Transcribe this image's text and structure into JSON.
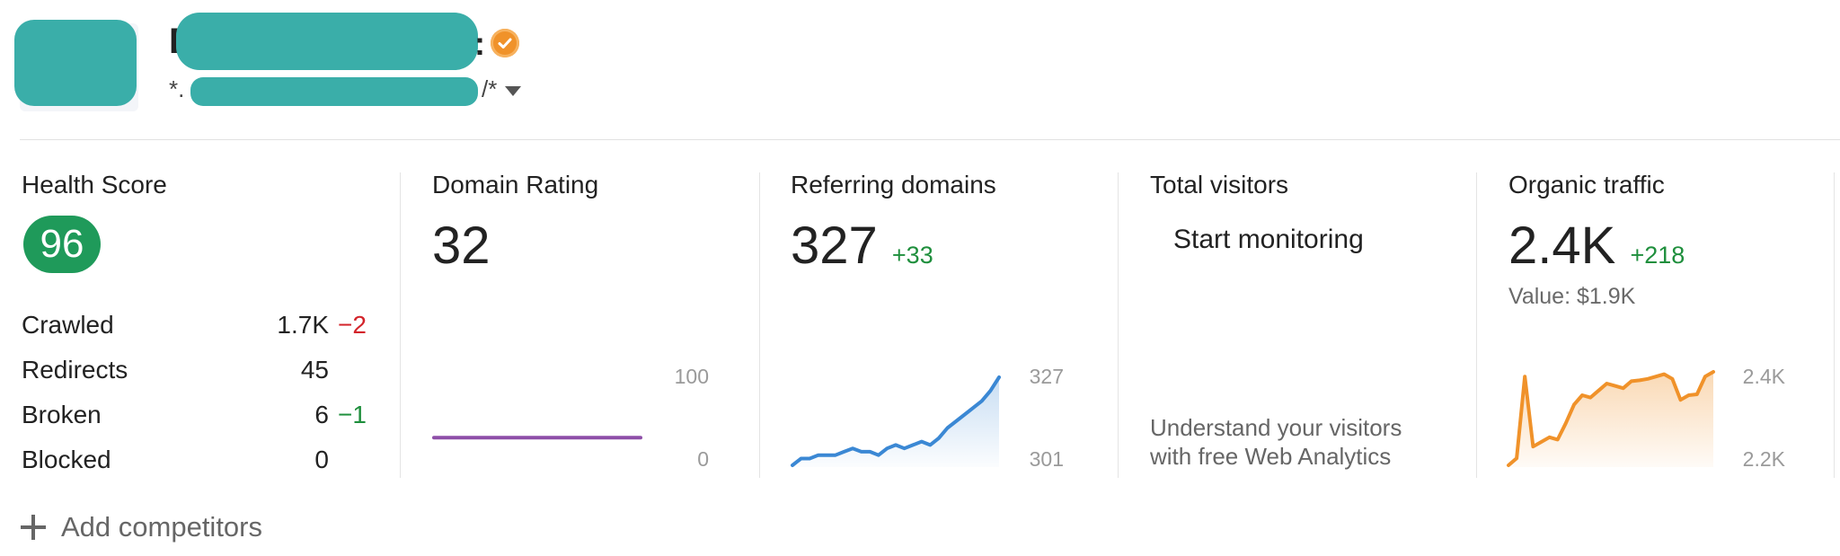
{
  "header": {
    "title_prefix": "E",
    "title_suffix": ":",
    "url_prefix": "*.",
    "url_suffix": "/*",
    "verified_icon": "verified-badge-icon",
    "accent_color": "#f0922a"
  },
  "health": {
    "label": "Health Score",
    "score": "96",
    "badge_color": "#1f9a5a",
    "rows": [
      {
        "label": "Crawled",
        "value": "1.7K",
        "delta": "−2",
        "delta_type": "down"
      },
      {
        "label": "Redirects",
        "value": "45",
        "delta": "",
        "delta_type": "none"
      },
      {
        "label": "Broken",
        "value": "6",
        "delta": "−1",
        "delta_type": "up"
      },
      {
        "label": "Blocked",
        "value": "0",
        "delta": "",
        "delta_type": "none"
      }
    ]
  },
  "domain_rating": {
    "label": "Domain Rating",
    "value": "32",
    "axis_max": "100",
    "axis_min": "0",
    "line_color": "#8e4fa8"
  },
  "referring_domains": {
    "label": "Referring domains",
    "value": "327",
    "delta": "+33",
    "axis_max": "327",
    "axis_min": "301",
    "line_color": "#3b88d4"
  },
  "total_visitors": {
    "label": "Total visitors",
    "cta": "Start monitoring",
    "description_line1": "Understand your visitors",
    "description_line2": "with free Web Analytics"
  },
  "organic_traffic": {
    "label": "Organic traffic",
    "value": "2.4K",
    "delta": "+218",
    "value_text": "Value: $1.9K",
    "axis_max": "2.4K",
    "axis_min": "2.2K",
    "line_color": "#f0922a"
  },
  "add_competitors": {
    "label": "Add competitors",
    "icon": "plus-icon"
  },
  "chart_data": [
    {
      "type": "line",
      "title": "Domain Rating",
      "ylim": [
        0,
        100
      ],
      "series": [
        {
          "values": [
            32,
            32,
            32,
            32,
            32,
            32,
            32,
            32,
            32,
            32,
            32,
            32
          ]
        }
      ]
    },
    {
      "type": "area",
      "title": "Referring domains",
      "ylim": [
        301,
        327
      ],
      "series": [
        {
          "values": [
            301,
            303,
            303,
            304,
            304,
            304,
            305,
            306,
            305,
            305,
            304,
            306,
            307,
            306,
            307,
            308,
            307,
            309,
            312,
            314,
            316,
            318,
            320,
            323,
            327
          ]
        }
      ]
    },
    {
      "type": "area",
      "title": "Organic traffic",
      "ylim": [
        2200,
        2400
      ],
      "series": [
        {
          "values": [
            2200,
            2215,
            2390,
            2240,
            2250,
            2260,
            2255,
            2290,
            2330,
            2350,
            2345,
            2360,
            2375,
            2370,
            2365,
            2380,
            2382,
            2385,
            2390,
            2395,
            2385,
            2340,
            2350,
            2352,
            2390,
            2400
          ]
        }
      ]
    }
  ]
}
